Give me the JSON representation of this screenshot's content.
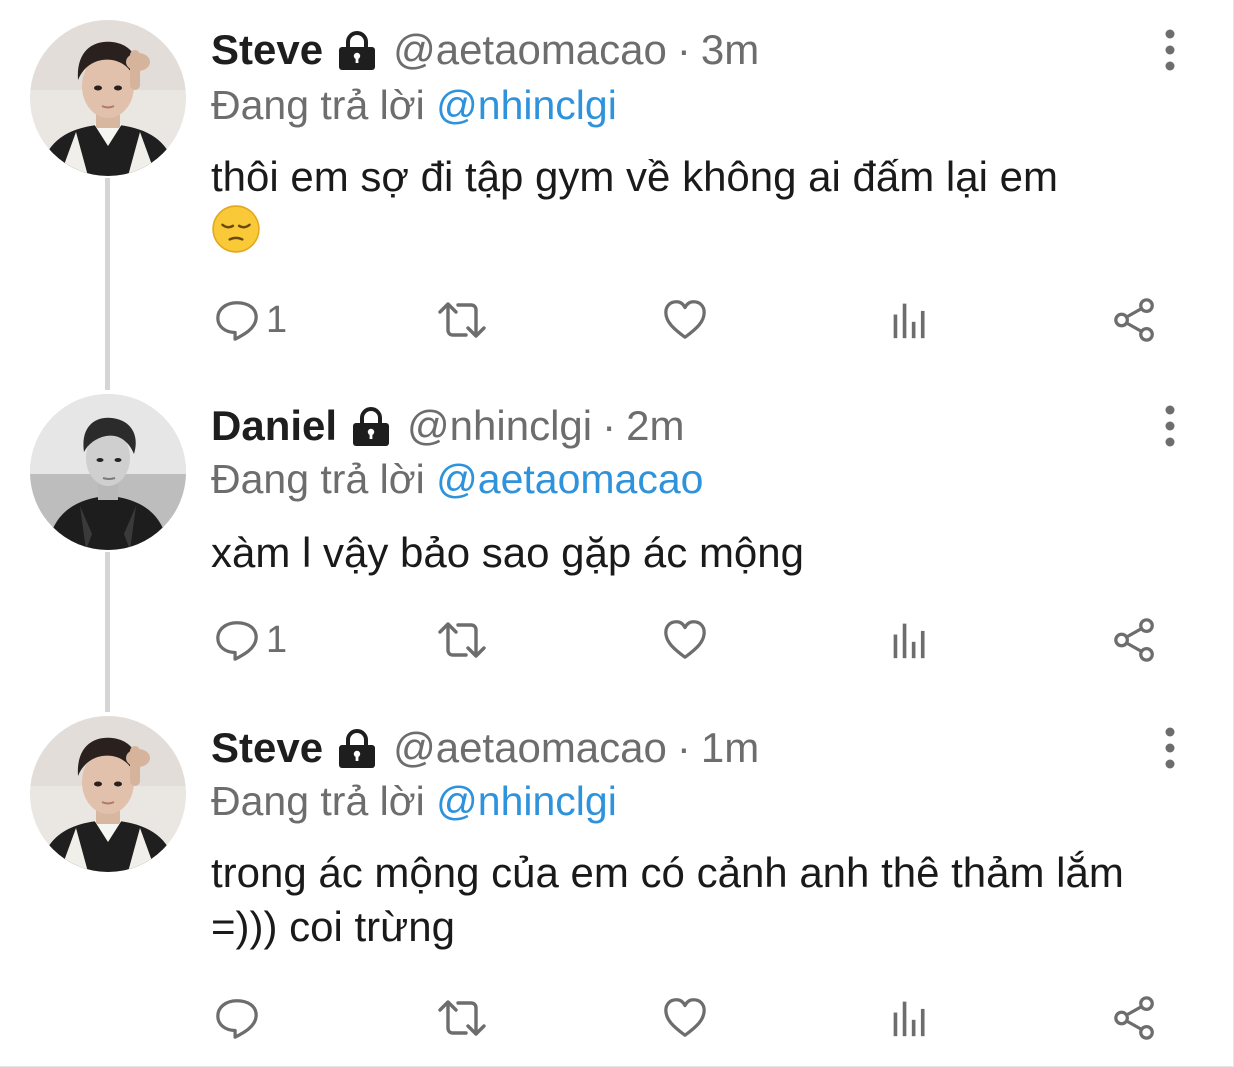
{
  "tweets": [
    {
      "display_name": "Steve",
      "handle": "@aetaomacao",
      "separator": "·",
      "time": "3m",
      "reply_prefix": "Đang trả lời",
      "reply_to": "@nhinclgi",
      "text": "thôi em sợ đi tập gym về không ai đấm lại em",
      "emoji": "pensive-face",
      "reply_count": "1",
      "avatar": "steve-avatar"
    },
    {
      "display_name": "Daniel",
      "handle": "@nhinclgi",
      "separator": "·",
      "time": "2m",
      "reply_prefix": "Đang trả lời",
      "reply_to": "@aetaomacao",
      "text": "xàm l vậy bảo sao gặp ác mộng",
      "reply_count": "1",
      "avatar": "daniel-avatar"
    },
    {
      "display_name": "Steve",
      "handle": "@aetaomacao",
      "separator": "·",
      "time": "1m",
      "reply_prefix": "Đang trả lời",
      "reply_to": "@nhinclgi",
      "text": "trong ác mộng của em có cảnh anh thê thảm lắm =))) coi trừng",
      "reply_count": "",
      "avatar": "steve-avatar"
    }
  ],
  "icons": {
    "lock": "lock-icon",
    "more": "more-vertical-icon",
    "reply": "reply-icon",
    "retweet": "retweet-icon",
    "like": "heart-icon",
    "analytics": "analytics-icon",
    "share": "share-icon"
  },
  "colors": {
    "link": "#2f93dc",
    "muted": "#6d6d6d",
    "thread_line": "#d5d5d5",
    "icon": "#6d6d6d"
  }
}
